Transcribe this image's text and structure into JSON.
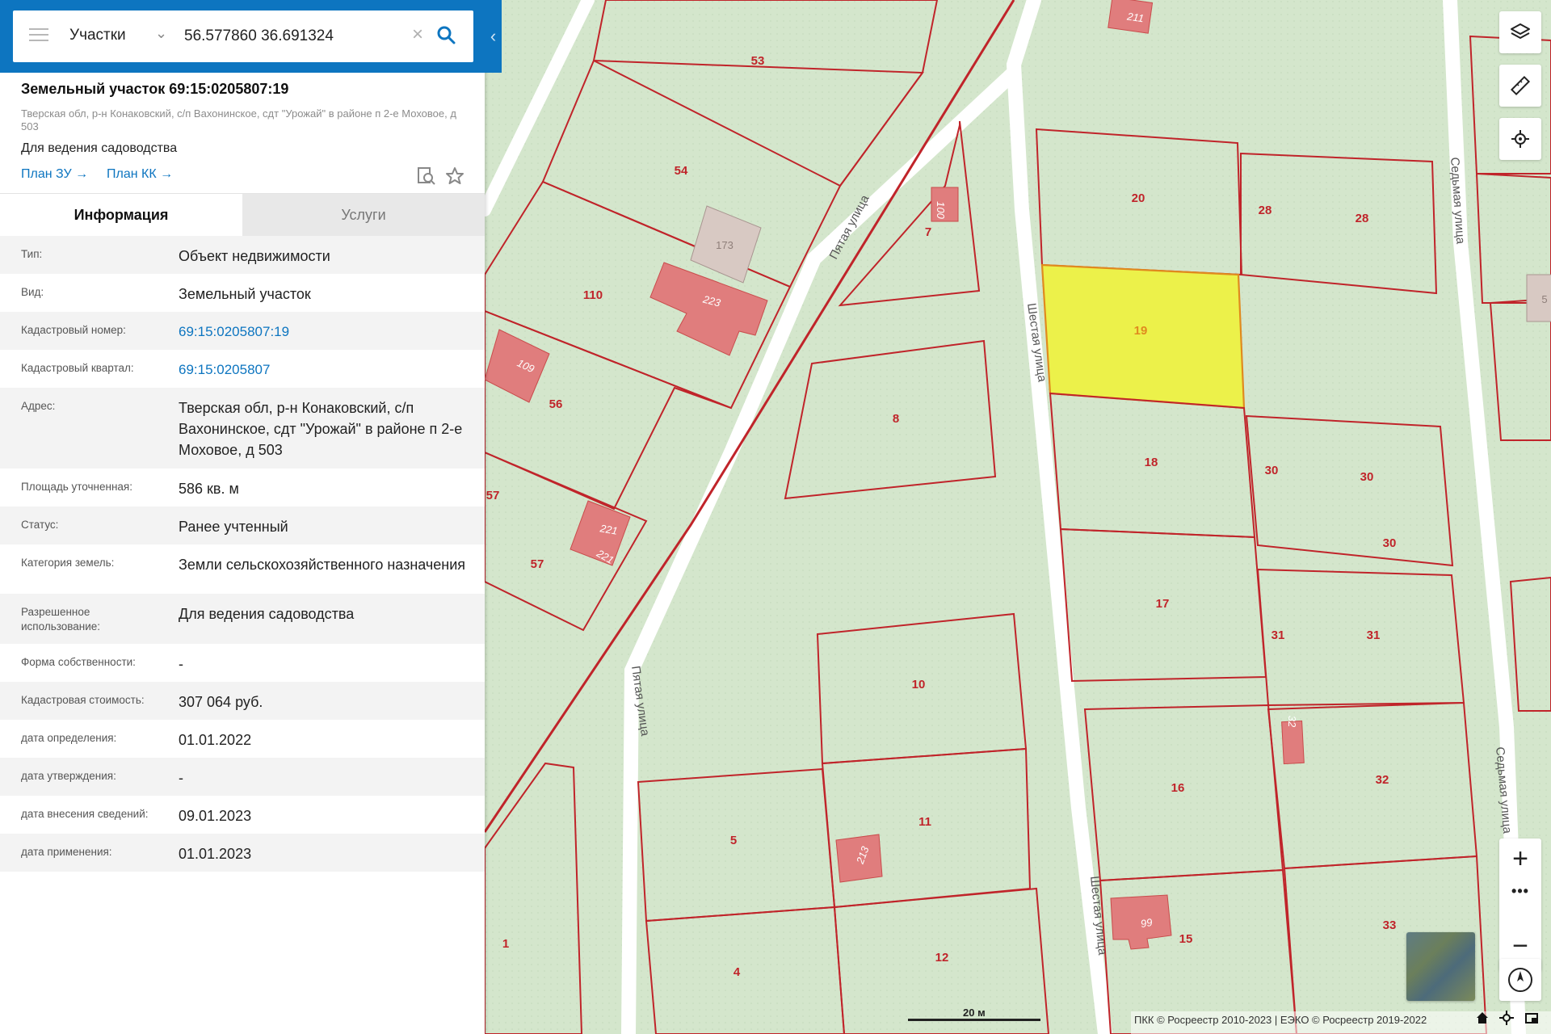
{
  "search": {
    "type_label": "Участки",
    "query": "56.577860 36.691324"
  },
  "parcel": {
    "title": "Земельный участок 69:15:0205807:19",
    "address_short": "Тверская обл, р-н Конаковский, с/п Вахонинское, сдт \"Урожай\" в районе п 2-е Моховое, д 503",
    "purpose": "Для ведения садоводства",
    "links": [
      "План ЗУ",
      "План КК"
    ]
  },
  "tabs": [
    "Информация",
    "Услуги"
  ],
  "info_rows": [
    {
      "label": "Тип:",
      "value": "Объект недвижимости"
    },
    {
      "label": "Вид:",
      "value": "Земельный участок"
    },
    {
      "label": "Кадастровый номер:",
      "value": "69:15:0205807:19"
    },
    {
      "label": "Кадастровый квартал:",
      "value": "69:15:0205807"
    },
    {
      "label": "Адрес:",
      "value": "Тверская обл, р-н Конаковский, с/п Вахонинское, сдт \"Урожай\" в районе п 2-е Моховое, д 503"
    },
    {
      "label": "Площадь уточненная:",
      "value": "586 кв. м"
    },
    {
      "label": "Статус:",
      "value": "Ранее учтенный"
    },
    {
      "label": "Категория земель:",
      "value": "Земли сельскохозяйственного назначения"
    },
    {
      "label": "Разрешенное использование:",
      "value": "Для ведения садоводства"
    },
    {
      "label": "Форма собственности:",
      "value": "-"
    },
    {
      "label": "Кадастровая стоимость:",
      "value": "307 064 руб."
    },
    {
      "label": "дата определения:",
      "value": "01.01.2022"
    },
    {
      "label": "дата утверждения:",
      "value": "-"
    },
    {
      "label": "дата внесения сведений:",
      "value": "09.01.2023"
    },
    {
      "label": "дата применения:",
      "value": "01.01.2023"
    }
  ],
  "map": {
    "streets": [
      "Пятая улица",
      "Пятая улица",
      "Шестая улица",
      "Шестая улица",
      "Седьмая улица",
      "Седьмая улица"
    ],
    "plot_numbers": [
      "53",
      "54",
      "110",
      "56",
      "57",
      "57",
      "20",
      "28",
      "28",
      "19",
      "18",
      "30",
      "30",
      "30",
      "17",
      "31",
      "31",
      "10",
      "16",
      "32",
      "5",
      "11",
      "15",
      "33",
      "4",
      "12",
      "1",
      "8",
      "7"
    ],
    "building_numbers": [
      "211",
      "223",
      "109",
      "221",
      "221",
      "100",
      "32",
      "213",
      "99"
    ],
    "building_grey": [
      "173",
      "5"
    ],
    "colors": {
      "plot_border": "#c0242a",
      "selected_fill": "#ecf14a",
      "building": "#e07d7d",
      "ground": "#d4e6cc"
    }
  },
  "scale_label": "20 м",
  "attribution": "ПКК © Росреестр 2010-2023 | ЕЭКО © Росреестр 2019-2022",
  "icons": {
    "layers": "layers-icon",
    "ruler": "ruler-icon",
    "locate": "locate-icon",
    "zoom_in": "plus-icon",
    "zoom_out": "minus-icon",
    "compass": "compass-icon",
    "home": "home-icon",
    "target": "crosshair-icon",
    "fullscreen": "fullscreen-icon"
  }
}
